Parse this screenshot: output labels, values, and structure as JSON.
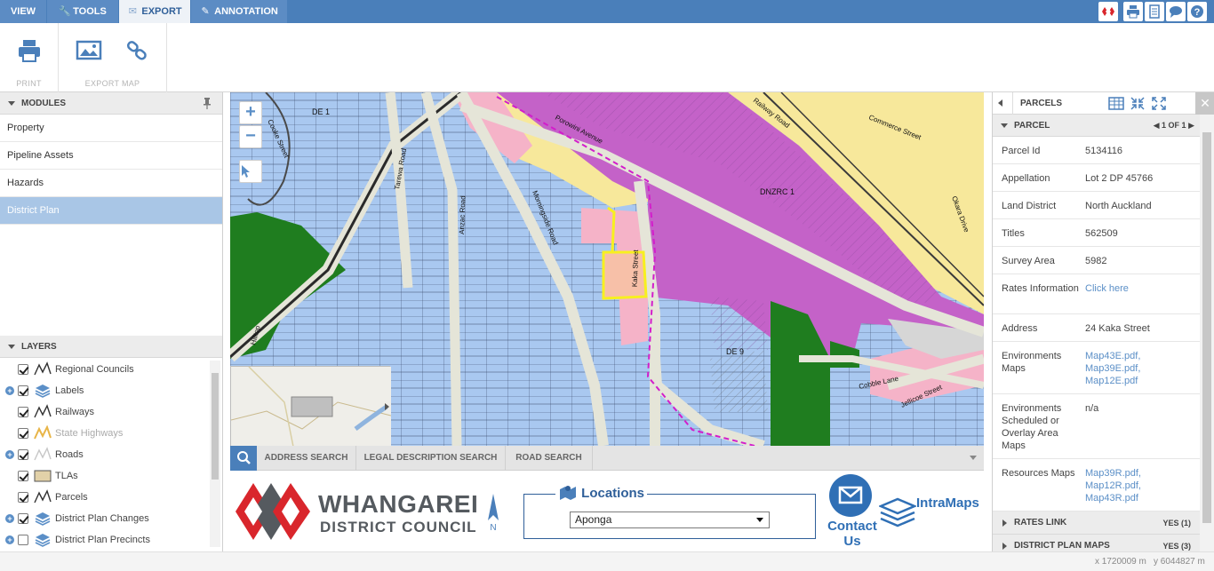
{
  "tabs": [
    {
      "label": "VIEW",
      "icon": ""
    },
    {
      "label": "TOOLS",
      "icon": "wrench-icon"
    },
    {
      "label": "EXPORT",
      "icon": "envelope-icon"
    },
    {
      "label": "ANNOTATION",
      "icon": "pencil-icon"
    }
  ],
  "active_tab": "EXPORT",
  "top_right_icons": [
    "wdc-logo-icon",
    "print-icon",
    "document-icon",
    "chat-icon",
    "help-icon"
  ],
  "ribbon": {
    "print_group_label": "PRINT",
    "export_group_label": "EXPORT MAP",
    "buttons": [
      "print-icon",
      "image-icon",
      "link-icon"
    ]
  },
  "modules": {
    "title": "MODULES",
    "items": [
      "Property",
      "Pipeline Assets",
      "Hazards",
      "District Plan"
    ],
    "active": "District Plan"
  },
  "layers": {
    "title": "LAYERS",
    "items": [
      {
        "label": "Regional Councils",
        "checked": true,
        "expandable": false,
        "dim": false,
        "icon": "line-icon"
      },
      {
        "label": "Labels",
        "checked": true,
        "expandable": true,
        "dim": false,
        "icon": "stack-icon"
      },
      {
        "label": "Railways",
        "checked": true,
        "expandable": false,
        "dim": false,
        "icon": "line-icon"
      },
      {
        "label": "State Highways",
        "checked": true,
        "expandable": false,
        "dim": true,
        "icon": "highway-line-icon"
      },
      {
        "label": "Roads",
        "checked": true,
        "expandable": true,
        "dim": false,
        "icon": "faint-line-icon"
      },
      {
        "label": "TLAs",
        "checked": true,
        "expandable": false,
        "dim": false,
        "icon": "polygon-icon"
      },
      {
        "label": "Parcels",
        "checked": true,
        "expandable": false,
        "dim": false,
        "icon": "line-icon"
      },
      {
        "label": "District Plan Changes",
        "checked": true,
        "expandable": true,
        "dim": false,
        "icon": "stack-icon"
      },
      {
        "label": "District Plan Precincts",
        "checked": false,
        "expandable": true,
        "dim": false,
        "icon": "stack-icon"
      }
    ]
  },
  "map": {
    "labels": [
      "DE 1",
      "DNZRC 1",
      "DE 9"
    ],
    "streets": [
      "Cooke Street",
      "Tarewa Road",
      "Anzac Road",
      "Morningside Road",
      "Porowini Avenue",
      "Kaka Street",
      "Railway Road",
      "Commerce Street",
      "Okara Drive",
      "Hilltop",
      "Cobble Lane",
      "Jellicoe Street"
    ],
    "controls": [
      "zoom-in-icon",
      "zoom-out-icon",
      "select-cursor-icon"
    ],
    "zoom_in": "+",
    "zoom_out": "−",
    "zone_colors": {
      "residential": "#a9c8f0",
      "business": "#c462c8",
      "commercial": "#f7e89b",
      "mixed": "#f5b3c8",
      "open_space": "#1f7d1f",
      "selected": "#f7c0a8"
    }
  },
  "search_tabs": [
    "ADDRESS SEARCH",
    "LEGAL DESCRIPTION SEARCH",
    "ROAD SEARCH"
  ],
  "branding": {
    "name": "WHANGAREI",
    "sub": "DISTRICT COUNCIL",
    "north": "N",
    "locations_title": "Locations",
    "location_value": "Aponga",
    "contact_line1": "Contact",
    "contact_line2": "Us",
    "intramaps": "IntraMaps"
  },
  "parcels": {
    "title": "PARCELS",
    "section": "PARCEL",
    "pager": "1 OF 1",
    "rows": [
      {
        "key": "Parcel Id",
        "value": [
          "5134116"
        ],
        "link": false
      },
      {
        "key": "Appellation",
        "value": [
          "Lot 2 DP 45766"
        ],
        "link": false
      },
      {
        "key": "Land District",
        "value": [
          "North Auckland"
        ],
        "link": false
      },
      {
        "key": "Titles",
        "value": [
          "562509"
        ],
        "link": false
      },
      {
        "key": "Survey Area",
        "value": [
          "5982"
        ],
        "link": false
      },
      {
        "key": "Rates Information",
        "value": [
          "Click here"
        ],
        "link": true
      },
      {
        "key": "Address",
        "value": [
          "24 Kaka Street"
        ],
        "link": false
      },
      {
        "key": "Environments Maps",
        "value": [
          "Map43E.pdf,",
          "Map39E.pdf,",
          "Map12E.pdf"
        ],
        "link": true
      },
      {
        "key": "Environments Scheduled or Overlay Area Maps",
        "value": [
          "n/a"
        ],
        "link": false
      },
      {
        "key": "Resources Maps",
        "value": [
          "Map39R.pdf,",
          "Map12R.pdf,",
          "Map43R.pdf"
        ],
        "link": true
      }
    ],
    "sections": [
      {
        "label": "RATES LINK",
        "count": "YES (1)"
      },
      {
        "label": "DISTRICT PLAN MAPS",
        "count": "YES (3)"
      }
    ]
  },
  "status": {
    "x_label": "x",
    "x": "1720009 m",
    "y_label": "y",
    "y": "6044827 m"
  }
}
